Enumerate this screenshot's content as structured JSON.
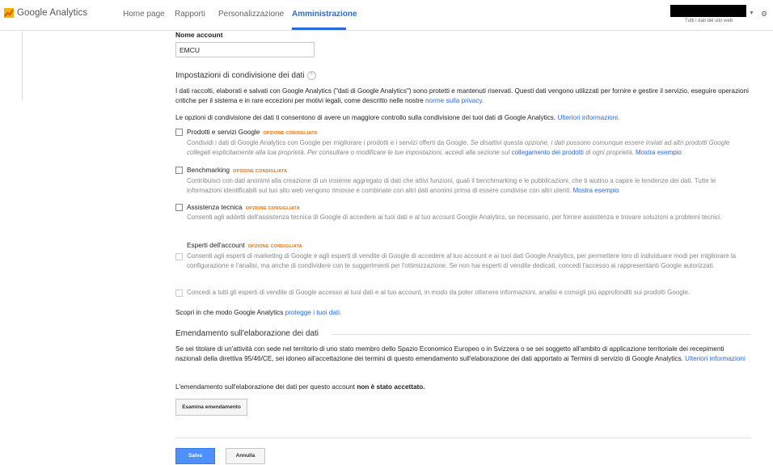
{
  "app": {
    "logo_text": "Google Analytics"
  },
  "nav": {
    "home": "Home page",
    "reports": "Rapporti",
    "custom": "Personalizzazione",
    "admin": "Amministrazione"
  },
  "account_header": {
    "subtitle": "Tutti i dati del sito web"
  },
  "account_name": {
    "label": "Nome account",
    "value": "EMCU"
  },
  "sharing": {
    "title": "Impostazioni di condivisione dei dati",
    "help": "?",
    "intro_text": "I dati raccolti, elaborati e salvati con Google Analytics (\"dati di Google Analytics\") sono protetti e mantenuti riservati. Questi dati vengono utilizzati per fornire e gestire il servizio, eseguire operazioni critiche per il sistema e in rare eccezioni per motivi legali, come descritto nelle nostre",
    "intro_link": "norme sulla privacy.",
    "options_text": "Le opzioni di condivisione dei dati ti consentono di avere un maggiore controllo sulla condivisione dei tuoi dati di Google Analytics.",
    "options_link": "Ulteriori informazioni.",
    "badge": "OPZIONE CONSIGLIATA",
    "opt1_title": "Prodotti e servizi Google",
    "opt1_desc_a": "Condividi i dati di Google Analytics con Google per migliorare i prodotti e i servizi offerti da Google.",
    "opt1_desc_b": "Se disattivi questa opzione, i dati possono comunque essere inviati ad altri prodotti Google collegati esplicitamente alla tua proprietà. Per consultare o modificare le tue impostazioni, accedi alla sezione sul",
    "opt1_link": "collegamento dei prodotti",
    "opt1_desc_c": "di ogni proprietà.",
    "opt1_example": "Mostra esempio",
    "opt2_title": "Benchmarking",
    "opt2_desc": "Contribuisci con dati anonimi alla creazione di un insieme aggregato di dati che attivi funzioni, quali il benchmarking e le pubblicazioni, che ti aiutino a capire le tendenze dei dati. Tutte le informazioni identificabili sul tuo sito web vengono rimosse e combinate con altri dati anonimi prima di essere condivise con altri utenti.",
    "opt2_example": "Mostra esempio",
    "opt3_title": "Assistenza tecnica",
    "opt3_desc": "Consenti agli addetti dell'assistenza tecnica di Google di accedere ai tuoi dati e al tuo account Google Analytics, se necessario, per fornire assistenza e trovare soluzioni a problemi tecnici.",
    "opt4_title": "Esperti dell'account",
    "opt4a_desc": "Consenti agli esperti di marketing di Google e agli esperti di vendite di Google di accedere al tuo account e ai tuoi dati Google Analytics, per permettere loro di individuare modi per migliorare la configurazione e l'analisi, ma anche di condividere con te suggerimenti per l'ottimizzazione. Se non hai esperti di vendite dedicati, concedi l'accesso ai rappresentanti Google autorizzati.",
    "opt4b_desc": "Concedi a tutti gli esperti di vendite di Google accesso ai tuoi dati e al tuo account, in modo da poter ottenere informazioni, analisi e consigli più approfonditi sui prodotti Google.",
    "discover_text": "Scopri in che modo Google Analytics",
    "discover_link": "protegge i tuoi dati."
  },
  "amendment": {
    "title": "Emendamento sull'elaborazione dei dati",
    "text": "Se sei titolare di un'attività con sede nel territorio di uno stato membro dello Spazio Economico Europeo o in Svizzera o se sei soggetto all'ambito di applicazione territoriale dei recepimenti nazionali della direttiva 95/46/CE, sei idoneo all'accettazione dei termini di questo emendamento sull'elaborazione dei dati apportato ai Termini di servizio di Google Analytics.",
    "link": "Ulteriori informazioni",
    "status_text": "L'emendamento sull'elaborazione dei dati per questo account",
    "status_strong": "non è stato accettato.",
    "review_button": "Esamina emendamento"
  },
  "footer": {
    "save": "Salva",
    "cancel": "Annulla"
  },
  "colors": {
    "accent": "#2a6cd6",
    "badge": "#e8710a",
    "primary_button": "#4d90fe"
  }
}
